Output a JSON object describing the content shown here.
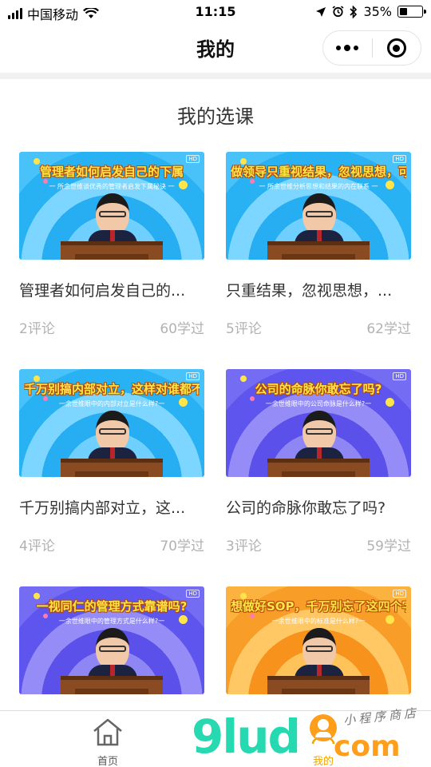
{
  "status_bar": {
    "carrier": "中国移动",
    "time": "11:15",
    "battery": "35%",
    "battery_level": 0.35
  },
  "nav": {
    "title": "我的"
  },
  "section_title": "我的选课",
  "courses": [
    {
      "title": "管理者如何启发自己的...",
      "comments": "2评论",
      "learners": "60学过",
      "thumb_headline": "管理者如何启发自己的下属",
      "thumb_sub": "一 所余世维谈优秀的管理者启发下属秘诀 一",
      "thumb_theme": "blue"
    },
    {
      "title": "只重结果，忽视思想，...",
      "comments": "5评论",
      "learners": "62学过",
      "thumb_headline": "做领导只重视结果，忽视思想，可以吗?",
      "thumb_sub": "一 所余世维分析思想和结果的内在联系 一",
      "thumb_theme": "blue"
    },
    {
      "title": "千万别搞内部对立，这...",
      "comments": "4评论",
      "learners": "70学过",
      "thumb_headline": "千万别搞内部对立，这样对谁都不好",
      "thumb_sub": "一余世维眼中的内部对立是什么样?一",
      "thumb_theme": "blue"
    },
    {
      "title": "公司的命脉你敢忘了吗?",
      "comments": "3评论",
      "learners": "59学过",
      "thumb_headline": "公司的命脉你敢忘了吗?",
      "thumb_sub": "一余世维眼中的公司命脉是什么样?一",
      "thumb_theme": "purple"
    },
    {
      "thumb_headline": "一视同仁的管理方式靠谱吗?",
      "thumb_sub": "一余世维眼中的管理方式是什么样?一",
      "thumb_theme": "purple"
    },
    {
      "thumb_headline": "想做好SOP，千万别忘了这四个字",
      "thumb_sub": "一余世维眼中的标准是什么样?一",
      "thumb_theme": "orange"
    }
  ],
  "tab_bar": {
    "home_label": "首页",
    "mine_label": "我的"
  },
  "watermark": {
    "logo_text": "9lud",
    "logo_suffix": "com",
    "logo_cn": "小程序商店"
  },
  "colors": {
    "accent": "#f0a500",
    "muted_text": "#b2b2b2"
  }
}
